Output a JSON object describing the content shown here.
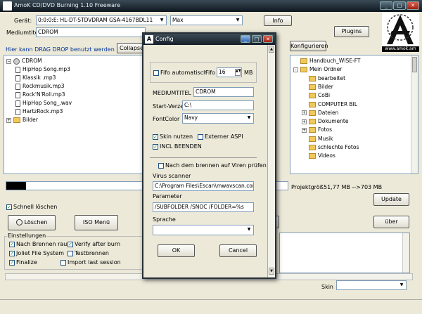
{
  "window": {
    "title": "AmoK CD/DVD Burning 1.10 Freeware"
  },
  "top": {
    "device_label": "Gerät:",
    "device_value": "0:0:0:E: HL-DT-STDVDRAM GSA-4167BDL11",
    "speed_value": "Max",
    "info_button": "Info",
    "mediumtitel_label": "Mediumtitel",
    "mediumtitel_value": "CDROM",
    "plugins_button": "Plugins",
    "drag_hint": "Hier kann DRAG DROP benutzt werden",
    "collapse_button": "Collapse t",
    "konfigurieren_button": "Konfigurieren",
    "logo_url": "www.amok.am"
  },
  "left_tree": {
    "root": "CDROM",
    "files": [
      "HipHop Song.mp3",
      "Klassik .mp3",
      "Rockmusik.mp3",
      "Rock'N'Roll.mp3",
      "HipHop Song_.wav",
      "HartzRock.mp3"
    ],
    "folder": "Bilder"
  },
  "right_tree": {
    "items": [
      {
        "label": "Handbuch_WISE-FT",
        "expander": "",
        "indent": 0
      },
      {
        "label": "Mein Ordner",
        "expander": "-",
        "indent": 0
      },
      {
        "label": "bearbeitet",
        "expander": "",
        "indent": 1
      },
      {
        "label": "Bilder",
        "expander": "",
        "indent": 1
      },
      {
        "label": "CoBi",
        "expander": "",
        "indent": 1
      },
      {
        "label": "COMPUTER BIL",
        "expander": "",
        "indent": 1
      },
      {
        "label": "Dateien",
        "expander": "+",
        "indent": 1
      },
      {
        "label": "Dokumente",
        "expander": "+",
        "indent": 1
      },
      {
        "label": "Fotos",
        "expander": "+",
        "indent": 1
      },
      {
        "label": "Musik",
        "expander": "",
        "indent": 1
      },
      {
        "label": "schlechte Fotos",
        "expander": "",
        "indent": 1
      },
      {
        "label": "Videos",
        "expander": "",
        "indent": 1
      }
    ]
  },
  "progress": {
    "fraction": 0.07
  },
  "projekt": {
    "label": "Projektgröß",
    "value": "51,77 MB -->703 MB"
  },
  "bottom": {
    "schnell_loeschen": "Schnell löschen",
    "loeschen_button": "Löschen",
    "iso_button": "ISO Menü",
    "update_button": "Update",
    "ueber_button": "über",
    "einstellungen": "Einstellungen",
    "opts": {
      "nach_brennen": "Nach Brennen raus",
      "verify": "Verify after burn",
      "joliet": "Joliet File System",
      "testbrennen": "Testbrennen",
      "finalize": "Finalize",
      "import_last": "Import last session"
    },
    "skin_label": "Skin"
  },
  "config": {
    "title": "Config",
    "fifo_auto": "Fifo automatisch",
    "fifo_label": "Fifo",
    "fifo_value": "16",
    "fifo_unit": "MB",
    "mediumtitel_label": "MEDIUMTITEL",
    "mediumtitel_value": "CDROM",
    "startverz_label": "Start-Verzeic",
    "startverz_value": "C:\\",
    "fontcolor_label": "FontColor",
    "fontcolor_value": "Navy",
    "skin_nutzen": "Skin nutzen",
    "externer_aspi": "Externer ASPI",
    "incl_beenden": "INCL BEENDEN",
    "nach_viren": "Nach dem brennen auf Viren prüfen",
    "virus_label": "Virus scanner",
    "virus_value": "C:\\Program Files\\Escan\\mwavscan.com",
    "param_label": "Parameter",
    "param_value": "/SUBFOLDER /SNOC /FOLDER=%s",
    "sprache_label": "Sprache",
    "sprache_value": "",
    "ok": "OK",
    "cancel": "Cancel"
  }
}
